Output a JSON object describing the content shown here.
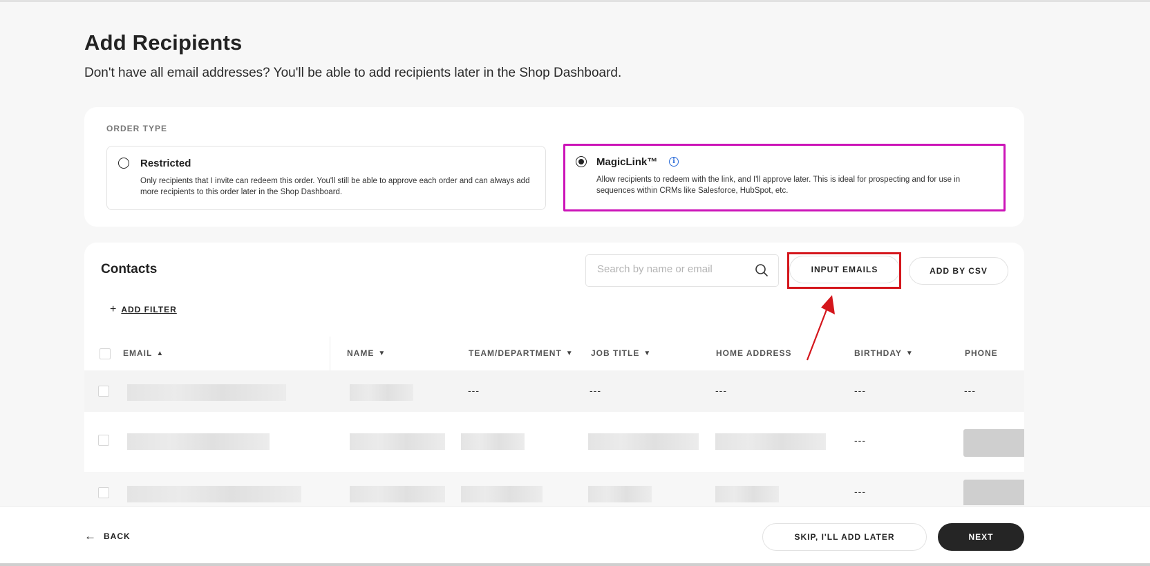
{
  "header": {
    "title": "Add Recipients",
    "subtitle": "Don't have all email addresses? You'll be able to add recipients later in the Shop Dashboard."
  },
  "order_type": {
    "label": "ORDER TYPE",
    "options": [
      {
        "title": "Restricted",
        "description": "Only recipients that I invite can redeem this order. You'll still be able to approve each order and can always add more recipients to this order later in the Shop Dashboard.",
        "selected": false
      },
      {
        "title": "MagicLink™",
        "description": "Allow recipients to redeem with the link, and I'll approve later. This is ideal for prospecting and for use in sequences within CRMs like Salesforce, HubSpot, etc.",
        "selected": true
      }
    ],
    "info_icon_glyph": "i",
    "highlight_color": "#cc14b8"
  },
  "contacts": {
    "title": "Contacts",
    "search_placeholder": "Search by name or email",
    "input_emails_label": "INPUT EMAILS",
    "add_csv_label": "ADD BY CSV",
    "add_filter_label": "ADD FILTER",
    "plus_glyph": "+",
    "highlight_color": "#d4161c",
    "columns": {
      "email": "EMAIL",
      "name": "NAME",
      "team": "TEAM/DEPARTMENT",
      "job": "JOB TITLE",
      "address": "HOME ADDRESS",
      "birthday": "BIRTHDAY",
      "phone": "PHONE"
    },
    "sort_asc_glyph": "▲",
    "sort_desc_glyph": "▼",
    "empty_value": "---"
  },
  "footer": {
    "back_label": "BACK",
    "back_glyph": "←",
    "skip_label": "SKIP, I'LL ADD LATER",
    "next_label": "NEXT"
  }
}
